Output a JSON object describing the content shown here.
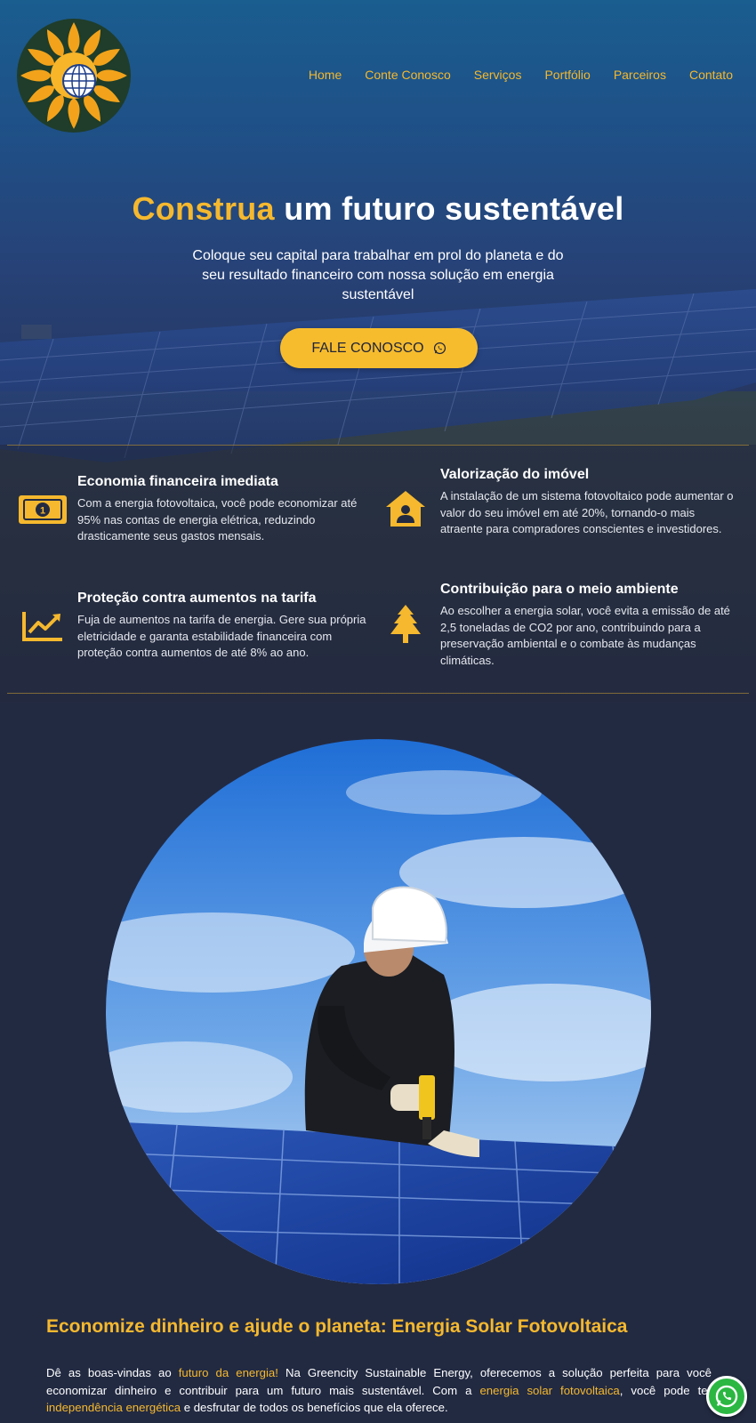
{
  "nav": {
    "items": [
      "Home",
      "Conte Conosco",
      "Serviços",
      "Portfólio",
      "Parceiros",
      "Contato"
    ]
  },
  "hero": {
    "title_accent": "Construa",
    "title_rest": "um futuro sustentável",
    "subtitle": "Coloque seu capital para trabalhar em prol do planeta e do seu resultado financeiro com nossa solução em energia sustentável",
    "cta_label": "FALE CONOSCO"
  },
  "features": [
    {
      "title": "Economia financeira imediata",
      "text": "Com a energia fotovoltaica, você pode economizar até 95% nas contas de energia elétrica, reduzindo drasticamente seus gastos mensais.",
      "icon": "money-bill-icon"
    },
    {
      "title": "Valorização do imóvel",
      "text": "A instalação de um sistema fotovoltaico pode aumentar o valor do seu imóvel em até 20%, tornando-o mais atraente para compradores conscientes e investidores.",
      "icon": "house-user-icon"
    },
    {
      "title": "Proteção contra aumentos na tarifa",
      "text": "Fuja de aumentos na tarifa de energia. Gere sua própria eletricidade e garanta estabilidade financeira com proteção contra aumentos de até 8% ao ano.",
      "icon": "chart-line-icon"
    },
    {
      "title": "Contribuição para o meio ambiente",
      "text": "Ao escolher a energia solar, você evita a emissão de até 2,5 toneladas de CO2 por ano, contribuindo para a preservação ambiental e o combate às mudanças climáticas.",
      "icon": "tree-icon"
    }
  ],
  "section": {
    "title": "Economize dinheiro e ajude o planeta: Energia Solar Fotovoltaica",
    "p_1": "Dê as boas-vindas ao ",
    "p_hl_1": "futuro da energia!",
    "p_2": " Na Greencity Sustainable Energy, oferecemos a solução perfeita para você economizar dinheiro e contribuir para um futuro mais sustentável. Com a ",
    "p_hl_2": "energia solar fotovoltaica",
    "p_3": ", você pode ter ",
    "p_hl_3": "independência energética",
    "p_4": " e desfrutar de todos os benefícios que ela oferece."
  },
  "colors": {
    "accent": "#f5b82e",
    "background": "#222a42",
    "whatsapp": "#2bb742"
  }
}
